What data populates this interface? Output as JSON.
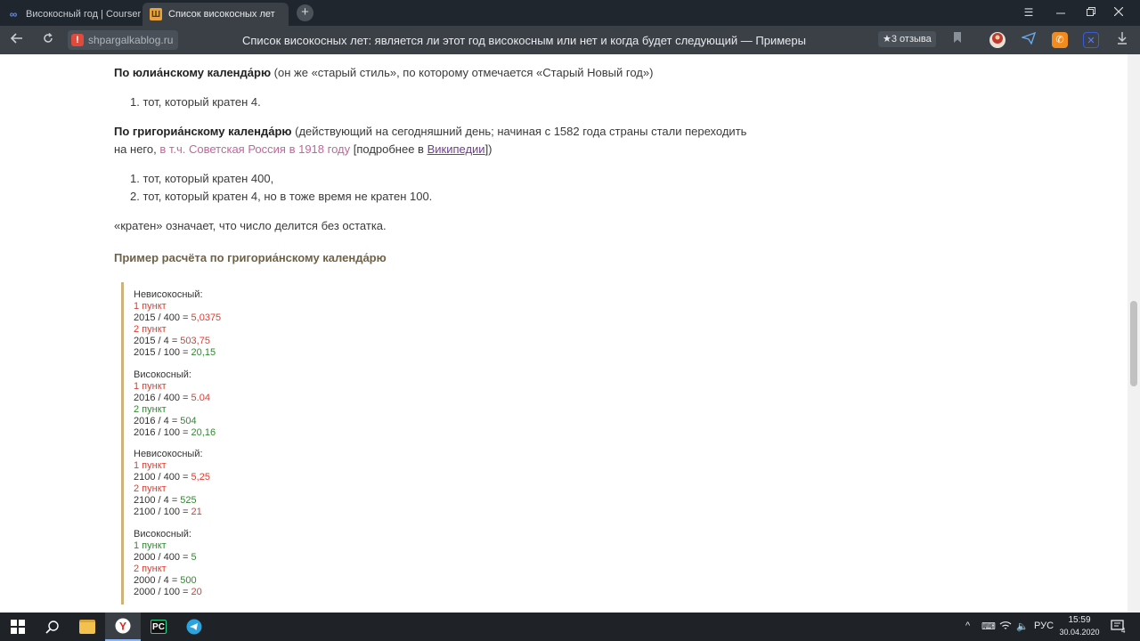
{
  "browser": {
    "tabs": [
      {
        "label": "Високосный год | Coursera"
      },
      {
        "label": "Список високосных лет"
      }
    ],
    "new_tab": "+",
    "domain": "shpargalkablog.ru",
    "page_title": "Список високосных лет: является ли этот год високосным или нет и когда будет следующий — Примеры",
    "reviews": "★3 отзыва"
  },
  "content": {
    "julian": {
      "bold": "По юлиа́нскому календа́рю",
      "rest": " (он же «старый стиль», по которому отмечается «Старый Новый год»)",
      "items": [
        "1. тот, который кратен 4."
      ]
    },
    "gregorian": {
      "bold": "По григориа́нскому календа́рю",
      "rest1": " (действующий на сегодняшний день; начиная с 1582 года страны стали переходить",
      "rest2": "на него, ",
      "link_russia": "в т.ч. Советская Россия в 1918 году",
      "rest3": " [подробнее в ",
      "link_wiki": "Википедии",
      "rest4": "])",
      "items": [
        "1. тот, который кратен 400,",
        "2. тот, который кратен 4, но в тоже время не кратен 100."
      ]
    },
    "definition": "«кратен» означает, что число делится без остатка.",
    "example_heading": "Пример расчёта по григориа́нскому календа́рю",
    "examples": [
      {
        "title": "Невисокосный:",
        "p1": "1 пункт",
        "p1_color": "#e03c31",
        "l1": "2015 / 400 = ",
        "v1": "5,0375",
        "v1_color": "#e03c31",
        "p2": "2 пункт",
        "p2_color": "#e03c31",
        "l2": "2015 / 4 = ",
        "v2": "503,75",
        "v2_color": "#e03c31",
        "l3": "2015 / 100 = ",
        "v3": "20,15",
        "v3_color": "#2e8b2e"
      },
      {
        "title": "Високосный:",
        "p1": "1 пункт",
        "p1_color": "#e03c31",
        "l1": "2016 / 400 = ",
        "v1": "5.04",
        "v1_color": "#e03c31",
        "p2": "2 пункт",
        "p2_color": "#2e8b2e",
        "l2": "2016 / 4 = ",
        "v2": "504",
        "v2_color": "#2e8b2e",
        "l3": "2016 / 100 = ",
        "v3": "20,16",
        "v3_color": "#2e8b2e"
      },
      {
        "title": "Невисокосный:",
        "p1": "1 пункт",
        "p1_color": "#e03c31",
        "l1": "2100 / 400 = ",
        "v1": "5,25",
        "v1_color": "#e03c31",
        "p2": "2 пункт",
        "p2_color": "#e03c31",
        "l2": "2100 / 4 = ",
        "v2": "525",
        "v2_color": "#2e8b2e",
        "l3": "2100 / 100 = ",
        "v3": "21",
        "v3_color": "#e03c31"
      },
      {
        "title": "Високосный:",
        "p1": "1 пункт",
        "p1_color": "#2e8b2e",
        "l1": "2000 / 400 = ",
        "v1": "5",
        "v1_color": "#2e8b2e",
        "p2": "2 пункт",
        "p2_color": "#e03c31",
        "l2": "2000 / 4 = ",
        "v2": "500",
        "v2_color": "#2e8b2e",
        "l3": "2000 / 100 = ",
        "v3": "20",
        "v3_color": "#e03c31"
      }
    ]
  },
  "taskbar": {
    "tray_lang": "РУС",
    "time": "15:59",
    "date": "30.04.2020",
    "notification_badge": "4"
  },
  "icons": {
    "tab1": "coursera-icon",
    "tab2": "site-favicon",
    "back": "back-arrow-icon",
    "reload": "reload-icon",
    "bookmark": "bookmark-icon",
    "download": "download-icon",
    "menu": "hamburger-menu-icon",
    "minimize": "minimize-icon",
    "restore": "restore-icon",
    "close": "close-icon",
    "start": "windows-start-icon",
    "search": "search-icon",
    "explorer": "folder-icon",
    "yandex": "yandex-browser-icon",
    "pycharm": "pycharm-icon",
    "telegram": "telegram-icon"
  },
  "colors": {
    "chrome_dark": "#20262d",
    "chrome_toolbar": "#3a4046",
    "accent_red": "#e03c31",
    "accent_green": "#2e8b2e",
    "link_pink": "#c0679a",
    "quote_border": "#cdb27a"
  }
}
